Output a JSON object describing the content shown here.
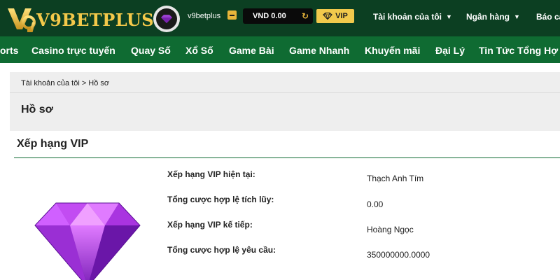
{
  "brand": {
    "logo_text": "V9BETPLUS",
    "accent_color": "#f4c94a",
    "header_color": "#0c3f22",
    "nav_color": "#0f6b32"
  },
  "header": {
    "username": "v9betplus",
    "balance": "VND 0.00",
    "vip_label": "VIP",
    "nav": [
      {
        "label": "Tài khoản của tôi"
      },
      {
        "label": "Ngân hàng"
      },
      {
        "label": "Báo cá"
      }
    ]
  },
  "main_nav": [
    {
      "label": "orts"
    },
    {
      "label": "Casino trực tuyến"
    },
    {
      "label": "Quay Số"
    },
    {
      "label": "Xổ Số"
    },
    {
      "label": "Game Bài"
    },
    {
      "label": "Game Nhanh"
    },
    {
      "label": "Khuyến mãi"
    },
    {
      "label": "Đại Lý"
    },
    {
      "label": "Tin Tức Tổng Hợ"
    }
  ],
  "breadcrumb": "Tài khoản của tôi > Hồ sơ",
  "page_title": "Hồ sơ",
  "vip": {
    "section_title": "Xếp hạng VIP",
    "gem_icon": "purple-gem-icon",
    "fields": [
      {
        "label": "Xếp hạng VIP hiện tại:",
        "value": "Thạch Anh Tím"
      },
      {
        "label": "Tổng cược hợp lệ tích lũy:",
        "value": "0.00"
      },
      {
        "label": "Xếp hạng VIP kế tiếp:",
        "value": "Hoàng Ngọc"
      },
      {
        "label": "Tổng cược hợp lệ yêu cầu:",
        "value": "350000000.0000"
      }
    ]
  }
}
